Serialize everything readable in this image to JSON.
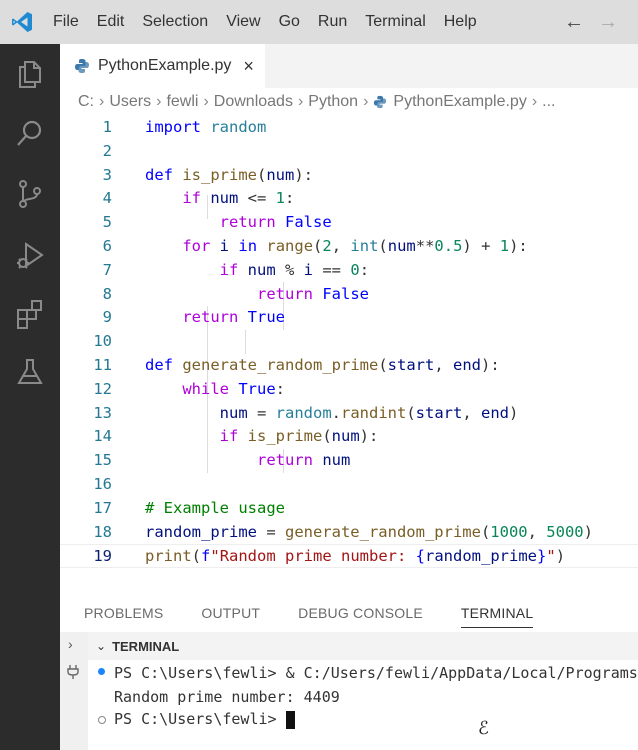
{
  "menu": {
    "items": [
      "File",
      "Edit",
      "Selection",
      "View",
      "Go",
      "Run",
      "Terminal",
      "Help"
    ]
  },
  "activity_icons": [
    "explorer-icon",
    "search-icon",
    "source-control-icon",
    "run-debug-icon",
    "extensions-icon",
    "testing-icon"
  ],
  "tab": {
    "label": "PythonExample.py",
    "close": "×"
  },
  "breadcrumb": {
    "items": [
      "C:",
      "Users",
      "fewli",
      "Downloads",
      "Python",
      "PythonExample.py",
      "..."
    ]
  },
  "editor": {
    "line_numbers": [
      "1",
      "2",
      "3",
      "4",
      "5",
      "6",
      "7",
      "8",
      "9",
      "10",
      "11",
      "12",
      "13",
      "14",
      "15",
      "16",
      "17",
      "18",
      "19"
    ]
  },
  "panel": {
    "tabs": [
      "PROBLEMS",
      "OUTPUT",
      "DEBUG CONSOLE",
      "TERMINAL"
    ],
    "active_tab": "TERMINAL",
    "terminal_title": "TERMINAL"
  },
  "terminal": {
    "line1": "PS C:\\Users\\fewli> & C:/Users/fewli/AppData/Local/Programs/",
    "line2": "Random prime number: 4409",
    "line3": "PS C:\\Users\\fewli> "
  },
  "colors": {
    "accent": "#007acc",
    "highlight": "#f7f748",
    "activitybar": "#2c2c2c"
  }
}
